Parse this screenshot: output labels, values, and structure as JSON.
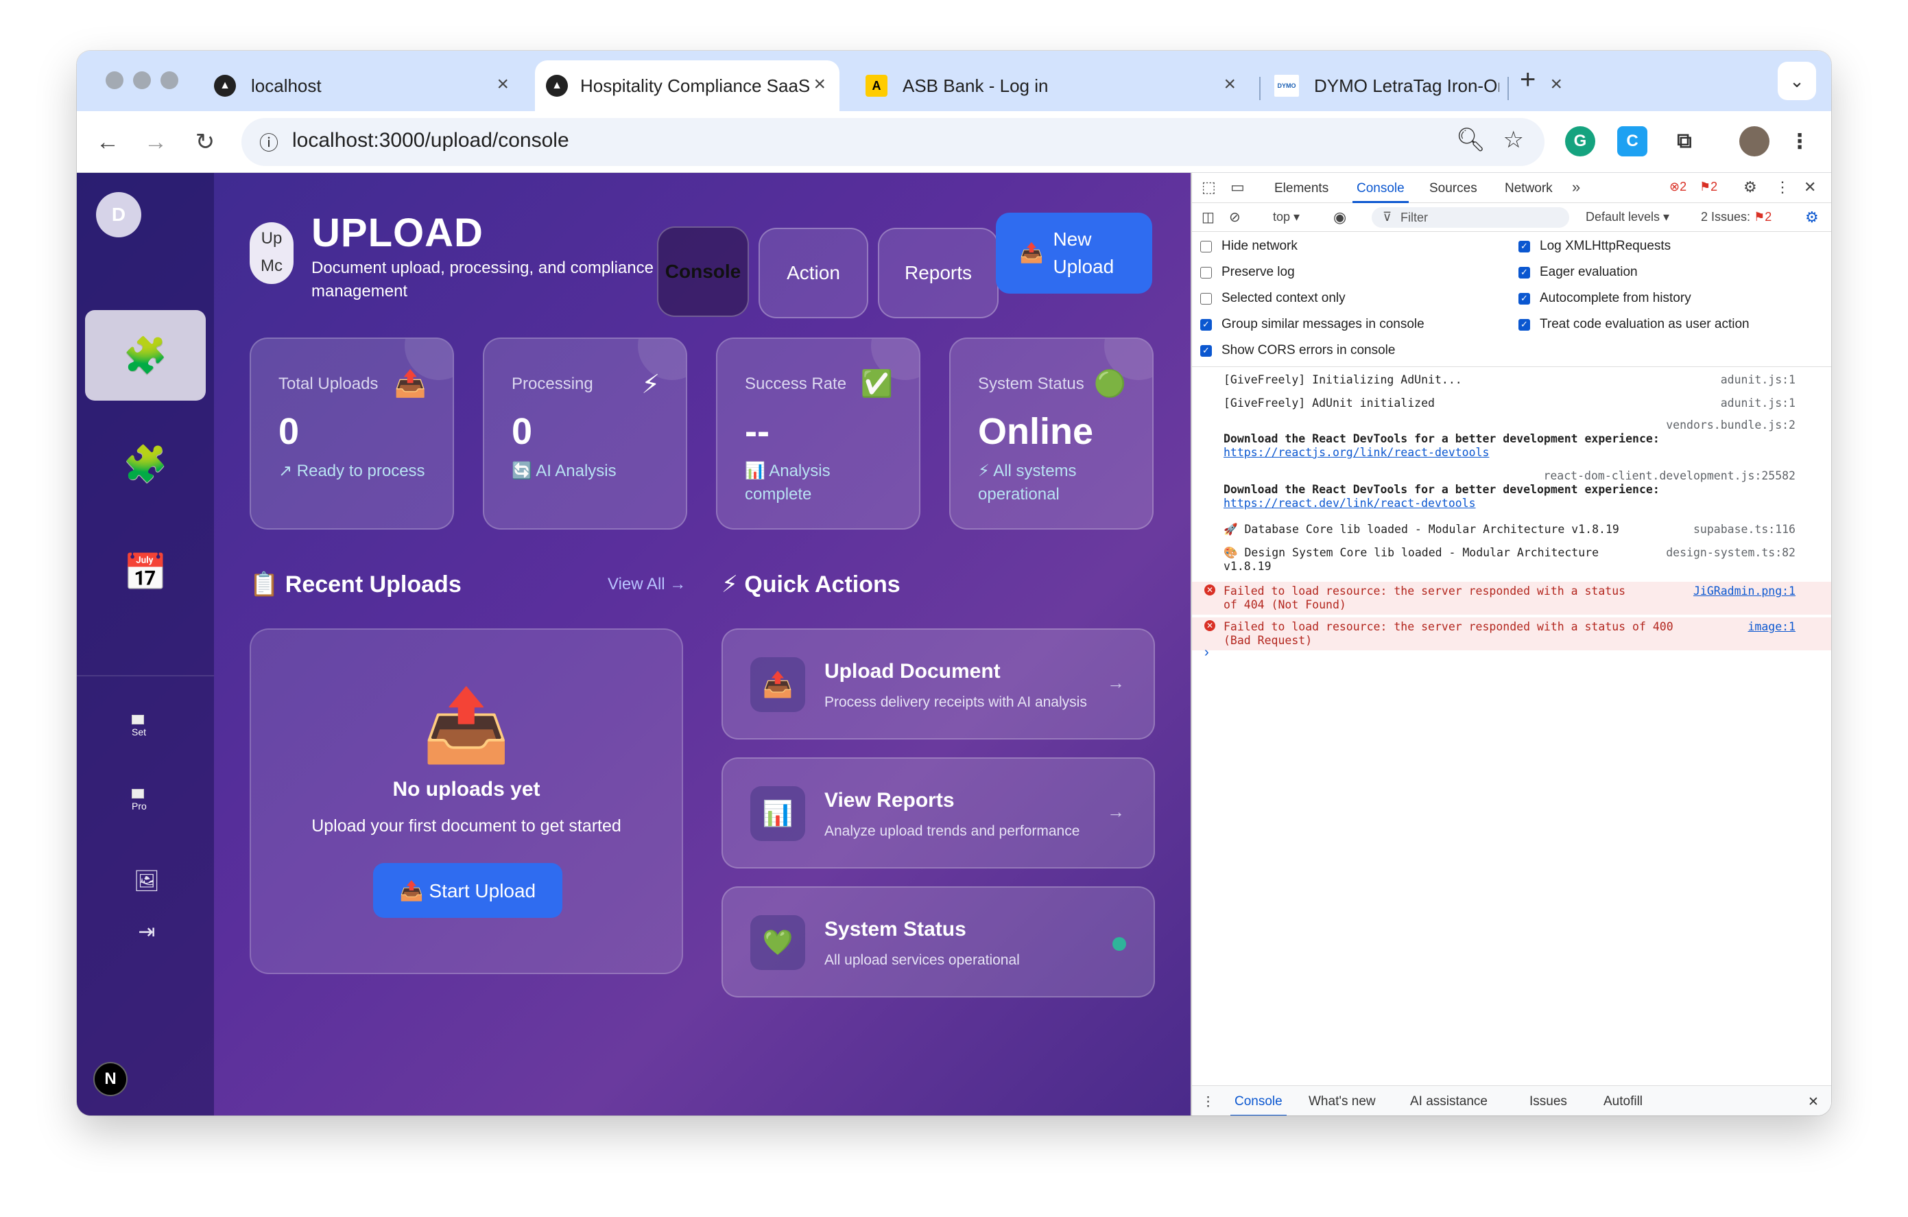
{
  "browser": {
    "tabs": [
      {
        "title": "localhost"
      },
      {
        "title": "Hospitality Compliance SaaS"
      },
      {
        "title": "ASB Bank - Log in"
      },
      {
        "title": "DYMO LetraTag Iron-On Fabri"
      }
    ],
    "url": "localhost:3000/upload/console"
  },
  "sidebar": {
    "avatar_letter": "D",
    "broken_1": "Set",
    "broken_2": "Pro",
    "badge": "N"
  },
  "header": {
    "logo_alt": "Up Mc",
    "title": "UPLOAD",
    "subtitle": "Document upload, processing, and compliance management",
    "buttons": {
      "console": "Console",
      "action": "Action",
      "reports": "Reports"
    },
    "new_upload": "New Upload"
  },
  "stats": [
    {
      "label": "Total Uploads",
      "icon": "📤",
      "value": "0",
      "sub": "↗ Ready to process"
    },
    {
      "label": "Processing",
      "icon": "⚡",
      "value": "0",
      "sub": "🔄 AI Analysis"
    },
    {
      "label": "Success Rate",
      "icon": "✅",
      "value": "--",
      "sub": "📊 Analysis complete"
    },
    {
      "label": "System Status",
      "icon": "🟢",
      "value": "Online",
      "sub": "⚡ All systems operational"
    }
  ],
  "recent": {
    "title": "📋 Recent Uploads",
    "view_all": "View All →",
    "icon": "📤",
    "empty_title": "No uploads yet",
    "empty_sub": "Upload your first document to get started",
    "start_button": "📤 Start Upload"
  },
  "quick_actions": {
    "title": "⚡ Quick Actions",
    "items": [
      {
        "icon": "📤",
        "title": "Upload Document",
        "sub": "Process delivery receipts with AI analysis",
        "arrow": "→"
      },
      {
        "icon": "📊",
        "title": "View Reports",
        "sub": "Analyze upload trends and performance",
        "arrow": "→"
      },
      {
        "icon": "💚",
        "title": "System Status",
        "sub": "All upload services operational"
      }
    ]
  },
  "devtools": {
    "tabs": [
      "Elements",
      "Console",
      "Sources",
      "Network"
    ],
    "errors_count": "2",
    "warnings_count": "2",
    "context": "top ▾",
    "filter_placeholder": "Filter",
    "levels": "Default levels ▾",
    "issues": "2 Issues:",
    "issues_count": "2",
    "options_left": [
      {
        "label": "Hide network",
        "checked": false
      },
      {
        "label": "Preserve log",
        "checked": false
      },
      {
        "label": "Selected context only",
        "checked": false
      },
      {
        "label": "Group similar messages in console",
        "checked": true
      },
      {
        "label": "Show CORS errors in console",
        "checked": true
      }
    ],
    "options_right": [
      {
        "label": "Log XMLHttpRequests",
        "checked": true
      },
      {
        "label": "Eager evaluation",
        "checked": true
      },
      {
        "label": "Autocomplete from history",
        "checked": true
      },
      {
        "label": "Treat code evaluation as user action",
        "checked": true
      }
    ],
    "logs": [
      {
        "text": "[GiveFreely] Initializing AdUnit...",
        "src": "adunit.js:1"
      },
      {
        "text": "[GiveFreely] AdUnit initialized",
        "src": "adunit.js:1"
      },
      {
        "src": "vendors.bundle.js:2",
        "bold": "Download the React DevTools for a better development experience:",
        "link": "https://reactjs.org/link/react-devtools"
      },
      {
        "src": "react-dom-client.development.js:25582",
        "bold": "Download the React DevTools for a better development experience:",
        "link": "https://react.dev/link/react-devtools"
      },
      {
        "text": "🚀 Database Core lib loaded - Modular Architecture v1.8.19",
        "src": "supabase.ts:116"
      },
      {
        "text": "🎨 Design System Core lib loaded - Modular Architecture",
        "text2": "v1.8.19",
        "src": "design-system.ts:82"
      },
      {
        "text": "Failed to load resource: the server responded with a status",
        "text2": "of 404 (Not Found)",
        "src": "JiGRadmin.png:1"
      },
      {
        "text": "Failed to load resource: the server responded with a status of 400",
        "text2": "(Bad Request)",
        "src": "image:1"
      }
    ],
    "prompt": "›",
    "bottom_tabs": [
      "Console",
      "What's new",
      "AI assistance",
      "Issues",
      "Autofill"
    ]
  }
}
